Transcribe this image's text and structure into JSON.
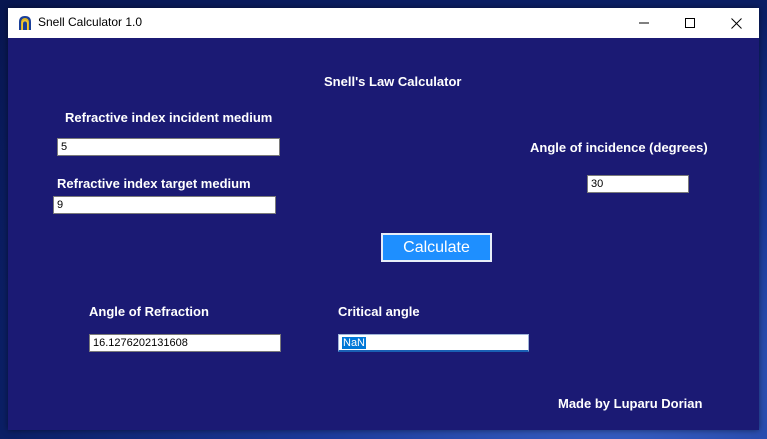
{
  "window": {
    "title": "Snell Calculator 1.0"
  },
  "form": {
    "heading": "Snell's Law Calculator",
    "incident_index_label": "Refractive index incident medium",
    "incident_index_value": "5",
    "target_index_label": "Refractive index target medium",
    "target_index_value": "9",
    "angle_incidence_label": "Angle of incidence (degrees)",
    "angle_incidence_value": "30",
    "calculate_label": "Calculate",
    "refraction_label": "Angle of Refraction",
    "refraction_value": "16.1276202131608",
    "critical_label": "Critical angle",
    "critical_value": "NaN",
    "credit": "Made by Luparu Dorian"
  },
  "colors": {
    "client_bg": "#1b1a74",
    "button_bg": "#1e8fff"
  },
  "icons": [
    "app-icon",
    "minimize-icon",
    "maximize-icon",
    "close-icon"
  ]
}
